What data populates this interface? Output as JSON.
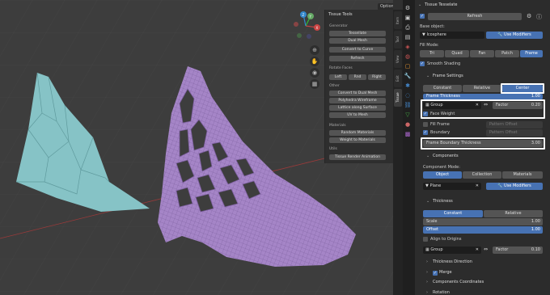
{
  "viewport": {
    "options_label": "Options",
    "gizmo": {
      "x": "X",
      "y": "Y",
      "z": "Z"
    }
  },
  "tool_panel": {
    "title": "Tissue Tools",
    "generator_label": "Generator",
    "generator_buttons": [
      "Tessellate",
      "Dual Mesh",
      "Convert to Curve",
      "Refresh"
    ],
    "rotate_label": "Rotate Faces",
    "rotate_buttons": [
      "Left",
      "Rnd",
      "Right"
    ],
    "other_label": "Other",
    "other_buttons": [
      "Convert to Dual Mesh",
      "Polyhedra Wireframe",
      "Lattice along Surface",
      "UV to Mesh"
    ],
    "materials_label": "Materials",
    "materials_buttons": [
      "Random Materials",
      "Weight to Materials"
    ],
    "utils_label": "Utils",
    "utils_buttons": [
      "Tissue Render Animation"
    ]
  },
  "tabs": [
    "Item",
    "Tool",
    "View",
    "Edit",
    "Tissue"
  ],
  "props": {
    "panel_title": "Tissue Tesselate",
    "refresh_label": "Refresh",
    "base_object_label": "Base object:",
    "base_object_value": "Icosphere",
    "use_modifiers_label": "Use Modifiers",
    "fill_mode_label": "Fill Mode:",
    "fill_modes": [
      "Tri",
      "Quad",
      "Fan",
      "Patch",
      "Frame"
    ],
    "fill_mode_selected": "Frame",
    "smooth_shading_label": "Smooth Shading",
    "frame_settings_label": "Frame Settings",
    "frame_modes": [
      "Constant",
      "Relative",
      "Center"
    ],
    "frame_mode_selected": "Center",
    "frame_thickness_label": "Frame Thickness",
    "frame_thickness_value": "1.00",
    "group_label": "Group",
    "factor_label": "Factor",
    "factor_value": "0.20",
    "face_weight_label": "Face Weight",
    "fill_frame_label": "Fill Frame",
    "pattern_offset_label": "Pattern Offset",
    "boundary_label": "Boundary",
    "frame_boundary_thickness_label": "Frame Boundary Thickness",
    "frame_boundary_thickness_value": "3.00",
    "components_label": "Components",
    "component_mode_label": "Component Mode:",
    "component_modes": [
      "Object",
      "Collection",
      "Materials"
    ],
    "component_mode_selected": "Object",
    "component_value": "Plane",
    "component_use_modifiers_label": "Use Modifiers",
    "thickness_label": "Thickness",
    "thickness_modes": [
      "Constant",
      "Relative"
    ],
    "thickness_mode_selected": "Constant",
    "scale_label": "Scale",
    "scale_value": "1.00",
    "offset_label": "Offset",
    "offset_value": "1.00",
    "align_origins_label": "Align to Origins",
    "group2_label": "Group",
    "factor2_label": "Factor",
    "factor2_value": "0.10",
    "thickness_direction_label": "Thickness Direction",
    "merge_label": "Merge",
    "components_coordinates_label": "Components Coordinates",
    "rotation_label": "Rotation"
  },
  "colors": {
    "viewport_bg": "#3d3d3d",
    "accent": "#4772b3",
    "teal_mesh": "#86c3c6",
    "purple_mesh": "#a585c7"
  }
}
